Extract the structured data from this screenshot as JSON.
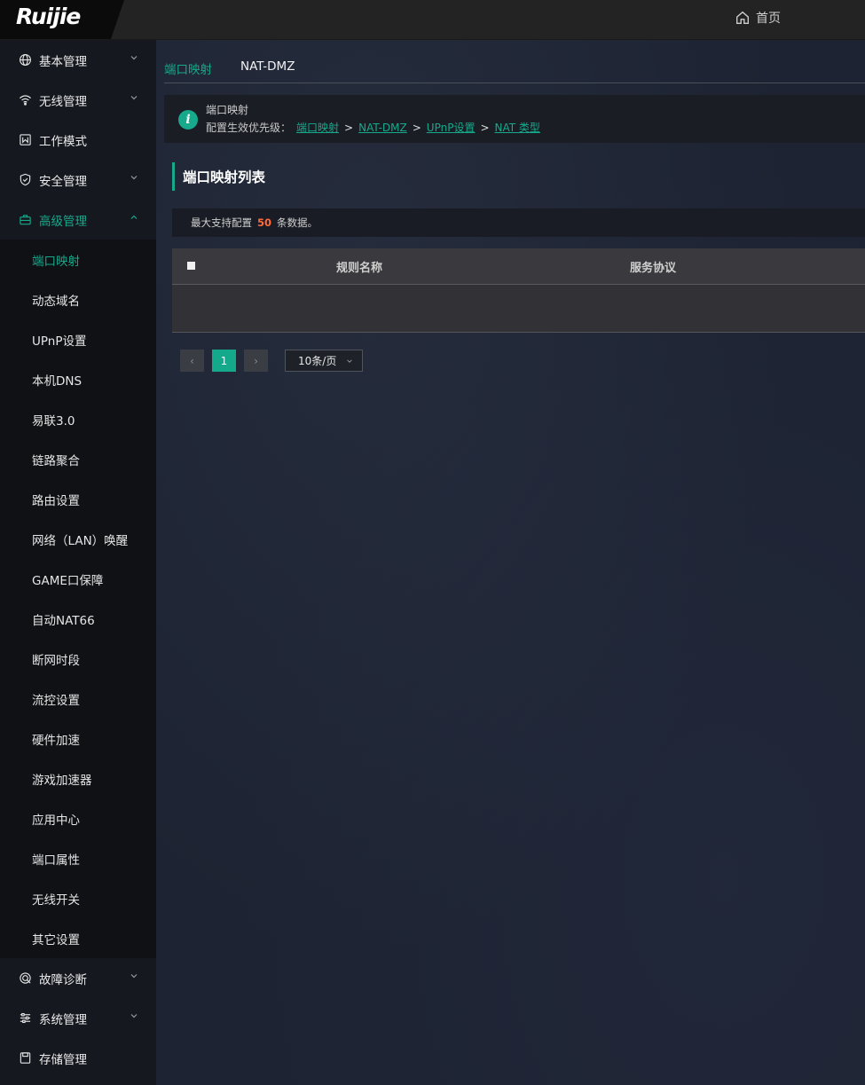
{
  "header": {
    "logo_text": "Ruijie",
    "home_label": "首页"
  },
  "sidebar": {
    "items_top": [
      {
        "label": "基本管理",
        "icon": "globe-icon",
        "has_chevron": true
      },
      {
        "label": "无线管理",
        "icon": "wifi-icon",
        "has_chevron": true
      },
      {
        "label": "工作模式",
        "icon": "mode-icon",
        "has_chevron": false
      },
      {
        "label": "安全管理",
        "icon": "shield-icon",
        "has_chevron": true
      },
      {
        "label": "高级管理",
        "icon": "toolbox-icon",
        "has_chevron": true,
        "expanded": true
      }
    ],
    "sub_items": [
      "端口映射",
      "动态域名",
      "UPnP设置",
      "本机DNS",
      "易联3.0",
      "链路聚合",
      "路由设置",
      "网络（LAN）唤醒",
      "GAME口保障",
      "自动NAT66",
      "断网时段",
      "流控设置",
      "硬件加速",
      "游戏加速器",
      "应用中心",
      "端口属性",
      "无线开关",
      "其它设置"
    ],
    "active_sub": "端口映射",
    "items_bottom": [
      {
        "label": "故障诊断",
        "icon": "diagnosis-icon",
        "has_chevron": true
      },
      {
        "label": "系统管理",
        "icon": "sliders-icon",
        "has_chevron": true
      },
      {
        "label": "存储管理",
        "icon": "storage-icon",
        "has_chevron": false
      }
    ]
  },
  "tabs": [
    {
      "label": "端口映射",
      "active": true
    },
    {
      "label": "NAT-DMZ",
      "active": false
    }
  ],
  "notice": {
    "title": "端口映射",
    "priority_prefix": "配置生效优先级：",
    "links": [
      "端口映射",
      "NAT-DMZ",
      "UPnP设置",
      "NAT 类型"
    ],
    "separator": ">"
  },
  "section": {
    "title": "端口映射列表",
    "limit_prefix": "最大支持配置",
    "limit_value": "50",
    "limit_suffix": "条数据。"
  },
  "table": {
    "columns": [
      "规则名称",
      "服务协议"
    ],
    "rows": []
  },
  "pagination": {
    "prev": "‹",
    "current_page": "1",
    "next": "›",
    "page_size": "10条/页"
  },
  "colors": {
    "accent": "#17a98c",
    "limit_number": "#ff6a3a"
  }
}
